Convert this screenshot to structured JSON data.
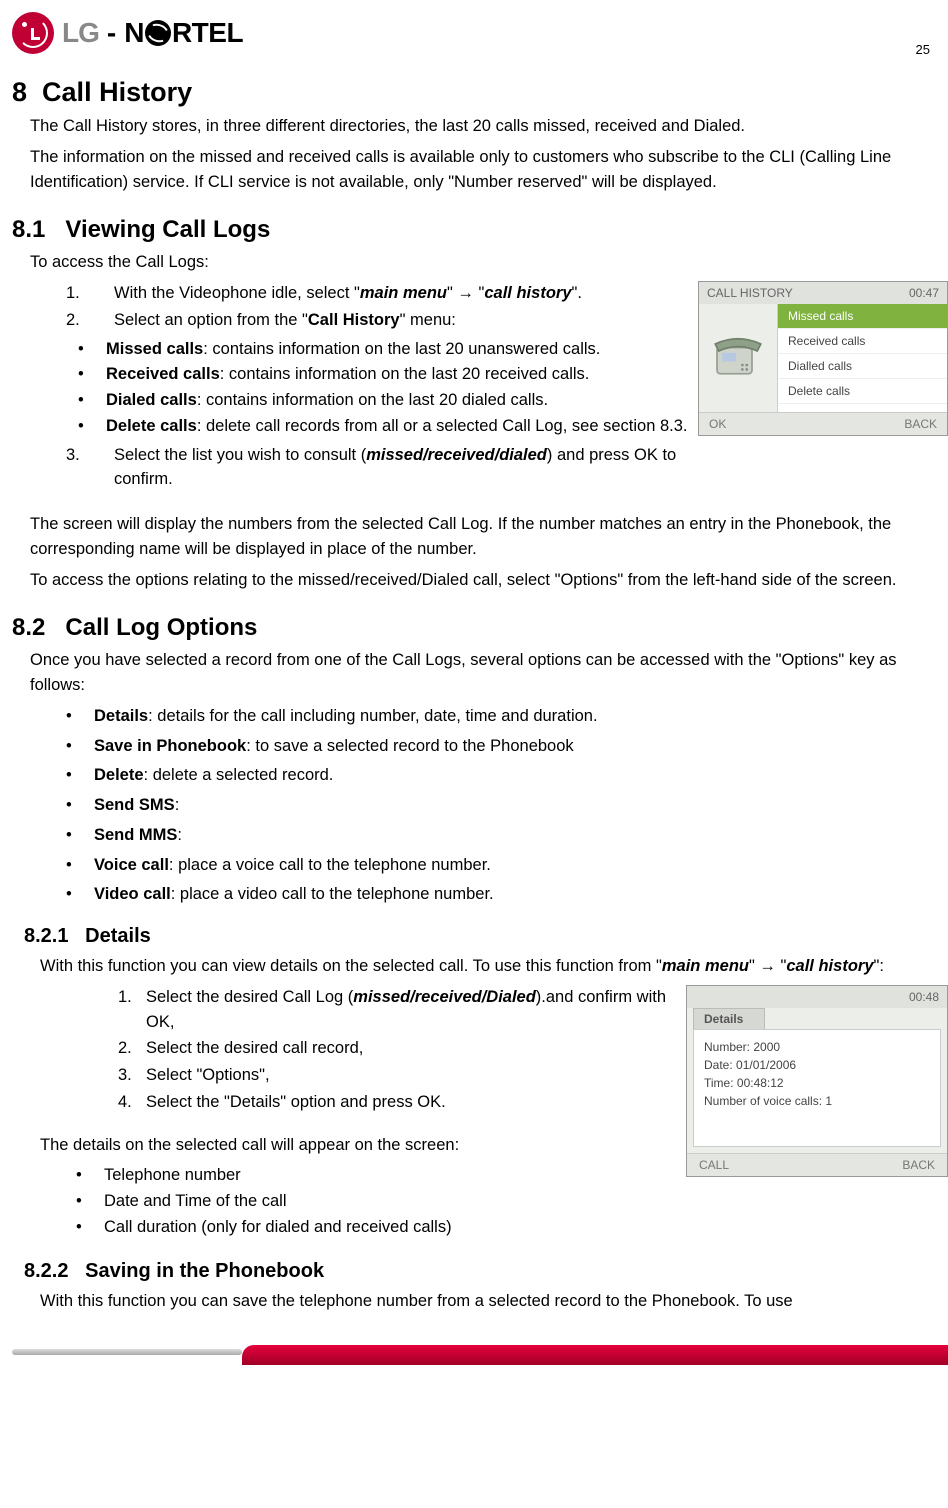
{
  "page_number": "25",
  "h1": {
    "num": "8",
    "title": "Call History"
  },
  "intro_p1": "The Call History stores, in three different directories, the last 20 calls missed, received and Dialed.",
  "intro_p2": "The information on the missed and received calls is available only to customers who subscribe to the CLI (Calling Line Identification) service. If CLI service is not available, only \"Number reserved\" will be displayed.",
  "s81": {
    "num": "8.1",
    "title": "Viewing Call Logs",
    "lead": "To access the Call Logs:",
    "step1_pre": "With the Videophone idle, select \"",
    "step1_m1": "main menu",
    "step1_mid": "\" → \"",
    "step1_m2": "call history",
    "step1_post": "\".",
    "step2_pre": "Select an option from the \"",
    "step2_b": "Call History",
    "step2_post": "\" menu:",
    "bul": [
      {
        "b": "Missed calls",
        "t": ": contains information on the last 20 unanswered calls."
      },
      {
        "b": "Received calls",
        "t": ": contains information on the last 20 received calls."
      },
      {
        "b": "Dialed calls",
        "t": ": contains information on the last 20 dialed calls."
      },
      {
        "b": "Delete calls",
        "t": ": delete call records from all or a selected Call Log, see section 8.3."
      }
    ],
    "step3_pre": "Select the list you wish to consult (",
    "step3_m": "missed/received/dialed",
    "step3_post": ") and press OK to confirm.",
    "after1": "The screen will display the numbers from the selected Call Log.  If the number matches an entry in the Phonebook, the corresponding name will be displayed in place of the number.",
    "after2": "To access the options relating to the missed/received/Dialed call, select \"Options\" from the left-hand side of the screen."
  },
  "shot1": {
    "title": "CALL HISTORY",
    "time": "00:47",
    "items": [
      "Missed calls",
      "Received calls",
      "Dialled calls",
      "Delete calls"
    ],
    "ok": "OK",
    "back": "BACK"
  },
  "s82": {
    "num": "8.2",
    "title": "Call Log Options",
    "lead": "Once you have selected a record from one of the Call Logs, several options can be accessed with the \"Options\" key as follows:",
    "opts": [
      {
        "b": "Details",
        "t": ": details for the call including number, date, time and duration."
      },
      {
        "b": "Save in Phonebook",
        "t": ": to save a selected record to the Phonebook"
      },
      {
        "b": "Delete",
        "t": ": delete a selected record."
      },
      {
        "b": "Send SMS",
        "t": ":"
      },
      {
        "b": "Send MMS",
        "t": ":"
      },
      {
        "b": "Voice call",
        "t": ": place a voice call to the telephone number."
      },
      {
        "b": "Video call",
        "t": ": place a video call to the telephone number."
      }
    ]
  },
  "s821": {
    "num": "8.2.1",
    "title": "Details",
    "p_pre": "With this function you can view details on the selected call.  To use this function from \"",
    "p_m1": "main menu",
    "p_mid": "\" → \"",
    "p_m2": "call history",
    "p_post": "\":",
    "steps_pre": [
      "Select the desired Call Log (",
      "Select the desired call record,",
      "Select \"Options\",",
      "Select the \"Details\" option and press OK."
    ],
    "step1_m": "missed/received/Dialed",
    "step1_post": ").and confirm with OK,",
    "details_lead": "The details on the selected call will appear on the screen:",
    "details": [
      "Telephone number",
      "Date and Time of the call",
      "Call duration (only for dialed and received calls)"
    ]
  },
  "shot2": {
    "time": "00:48",
    "tab": "Details",
    "lines": [
      "Number: 2000",
      "Date: 01/01/2006",
      "Time: 00:48:12",
      "Number of voice calls: 1"
    ],
    "call": "CALL",
    "back": "BACK"
  },
  "s822": {
    "num": "8.2.2",
    "title": "Saving in the Phonebook",
    "p": "With this function you can save the telephone number from a selected record to the Phonebook. To use"
  }
}
